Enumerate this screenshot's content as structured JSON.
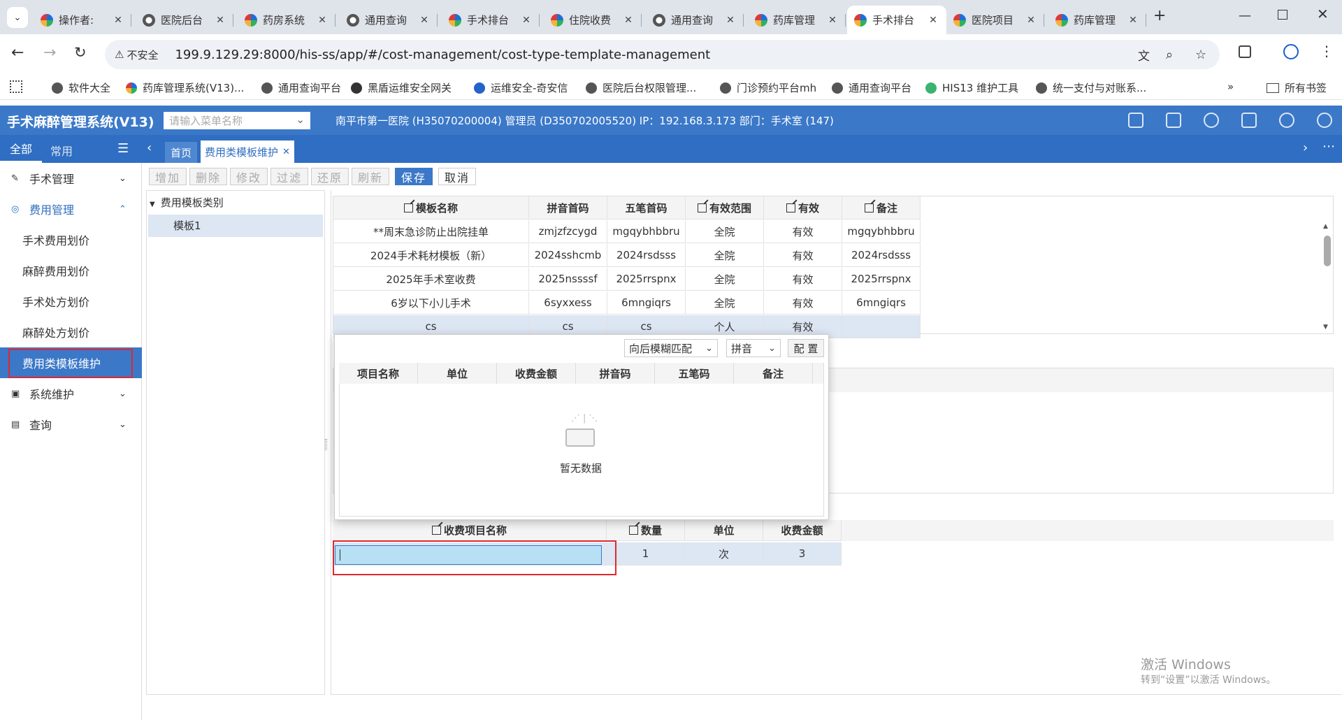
{
  "browser": {
    "tabs": [
      {
        "label": "操作者:",
        "icon": "colorful-logo-icon"
      },
      {
        "label": "医院后台",
        "icon": "globe-icon"
      },
      {
        "label": "药房系统",
        "icon": "colorful-logo-icon"
      },
      {
        "label": "通用查询",
        "icon": "globe-icon"
      },
      {
        "label": "手术排台",
        "icon": "colorful-logo-icon"
      },
      {
        "label": "住院收费",
        "icon": "colorful-logo-icon"
      },
      {
        "label": "通用查询",
        "icon": "globe-icon"
      },
      {
        "label": "药库管理",
        "icon": "colorful-logo-icon"
      },
      {
        "label": "手术排台",
        "icon": "colorful-logo-icon"
      },
      {
        "label": "医院项目",
        "icon": "colorful-logo-icon"
      },
      {
        "label": "药库管理",
        "icon": "colorful-logo-icon"
      }
    ],
    "security_label": "不安全",
    "url": "199.9.129.29:8000/his-ss/app/#/cost-management/cost-type-template-management",
    "bookmarks": [
      "软件大全",
      "药库管理系统(V13)...",
      "通用查询平台",
      "黑盾运维安全网关",
      "运维安全-奇安信",
      "医院后台权限管理...",
      "门诊预约平台mh",
      "通用查询平台",
      "HIS13 维护工具",
      "统一支付与对账系..."
    ],
    "all_bookmarks": "所有书签",
    "more": "»"
  },
  "app": {
    "title": "手术麻醉管理系统(V13)",
    "menu_search_placeholder": "请输入菜单名称",
    "info": "南平市第一医院 (H35070200004) 管理员 (D350702005520) IP：192.168.3.173 部门：手术室 (147)"
  },
  "nav": {
    "tab_all": "全部",
    "tab_common": "常用",
    "home": "首页",
    "active_tab": "费用类模板维护",
    "active_tab_close": "✕"
  },
  "sidebar": {
    "groups": [
      {
        "label": "手术管理",
        "icon": "scalpel-icon"
      },
      {
        "label": "费用管理",
        "icon": "money-icon"
      },
      {
        "label": "系统维护",
        "icon": "settings-icon"
      },
      {
        "label": "查询",
        "icon": "search-icon"
      }
    ],
    "sub_items": [
      "手术费用划价",
      "麻醉费用划价",
      "手术处方划价",
      "麻醉处方划价",
      "费用类模板维护"
    ]
  },
  "toolbar": {
    "add": "增加",
    "delete": "删除",
    "modify": "修改",
    "filter": "过滤",
    "restore": "还原",
    "refresh": "刷新",
    "save": "保存",
    "cancel": "取消"
  },
  "tree": {
    "root": "费用模板类别",
    "child": "模板1"
  },
  "template_grid": {
    "headers": [
      "模板名称",
      "拼音首码",
      "五笔首码",
      "有效范围",
      "有效",
      "备注"
    ],
    "rows": [
      [
        "**周末急诊防止出院挂单",
        "zmjzfzcygd",
        "mgqybhbbru",
        "全院",
        "有效",
        "mgqybhbbru"
      ],
      [
        "2024手术耗材模板（新）",
        "2024sshcmb",
        "2024rsdsss",
        "全院",
        "有效",
        "2024rsdsss"
      ],
      [
        "2025年手术室收费",
        "2025nssssf",
        "2025rrspnx",
        "全院",
        "有效",
        "2025rrspnx"
      ],
      [
        "6岁以下小儿手术",
        "6syxxess",
        "6mngiqrs",
        "全院",
        "有效",
        "6mngiqrs"
      ],
      [
        "cs",
        "cs",
        "cs",
        "个人",
        "有效",
        ""
      ]
    ]
  },
  "popup": {
    "match_mode": "向后模糊匹配",
    "input_mode": "拼音",
    "config": "配 置",
    "headers": [
      "项目名称",
      "单位",
      "收费金额",
      "拼音码",
      "五笔码",
      "备注"
    ],
    "empty_text": "暂无数据"
  },
  "item_grid": {
    "headers": [
      "收费项目名称",
      "数量",
      "单位",
      "收费金额"
    ],
    "row": {
      "name": "",
      "qty": "1",
      "unit": "次",
      "amount": "3"
    }
  },
  "watermark": {
    "line1": "激活 Windows",
    "line2": "转到“设置”以激活 Windows。"
  }
}
